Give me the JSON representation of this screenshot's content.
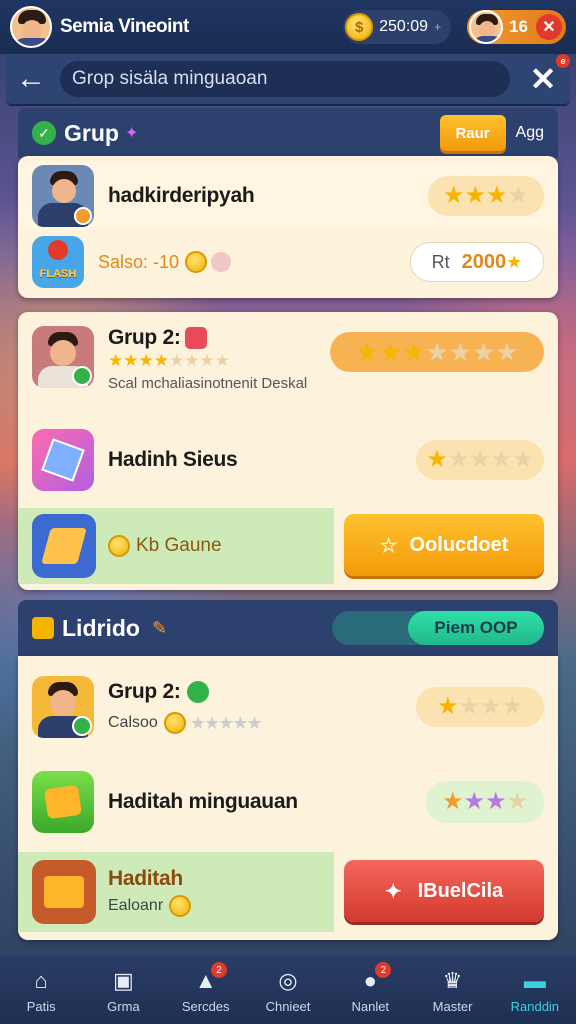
{
  "header": {
    "username": "Semia Vineoint",
    "coins": "250:09",
    "coin_plus": "+",
    "lives": "16",
    "close": "✕"
  },
  "search": {
    "back": "←",
    "placeholder": "Grop sisäla minguaoan",
    "close": "✕"
  },
  "section1": {
    "title": "Grup",
    "btn_primary": "Raur",
    "btn_secondary": "Agg",
    "row1_title": "hadkirderipyah",
    "row1_stars": 3,
    "row2_label": "Salso: -10",
    "row2_reward": "Rt",
    "row2_value": "2000"
  },
  "card2": {
    "title": "Grup 2:",
    "stars": 4,
    "desc": "Scal mchaliasinotnenit Deskal",
    "row2_title": "Hadinh Sieus",
    "row2_stars": 1,
    "row3_label": "Kb Gaune",
    "row3_button": "Oolucdoet",
    "top_stars": 3
  },
  "section3": {
    "title": "Lidrido",
    "button": "Piem OOP",
    "row1_title": "Grup 2:",
    "row1_sub": "Calsoo",
    "row1_stars": 1,
    "row2_title": "Haditah minguauan",
    "row3_title": "Haditah",
    "row3_sub": "Ealoanr",
    "row3_button": "IBuelCila"
  },
  "nav": [
    {
      "label": "Patis",
      "icon": "home-icon"
    },
    {
      "label": "Grma",
      "icon": "game-icon"
    },
    {
      "label": "Sercdes",
      "icon": "shop-icon",
      "badge": "2"
    },
    {
      "label": "Chnieet",
      "icon": "circle-icon"
    },
    {
      "label": "Nanlet",
      "icon": "profile-icon",
      "badge": "2"
    },
    {
      "label": "Master",
      "icon": "crown-icon"
    },
    {
      "label": "Randdin",
      "icon": "chat-icon",
      "active": true
    }
  ]
}
